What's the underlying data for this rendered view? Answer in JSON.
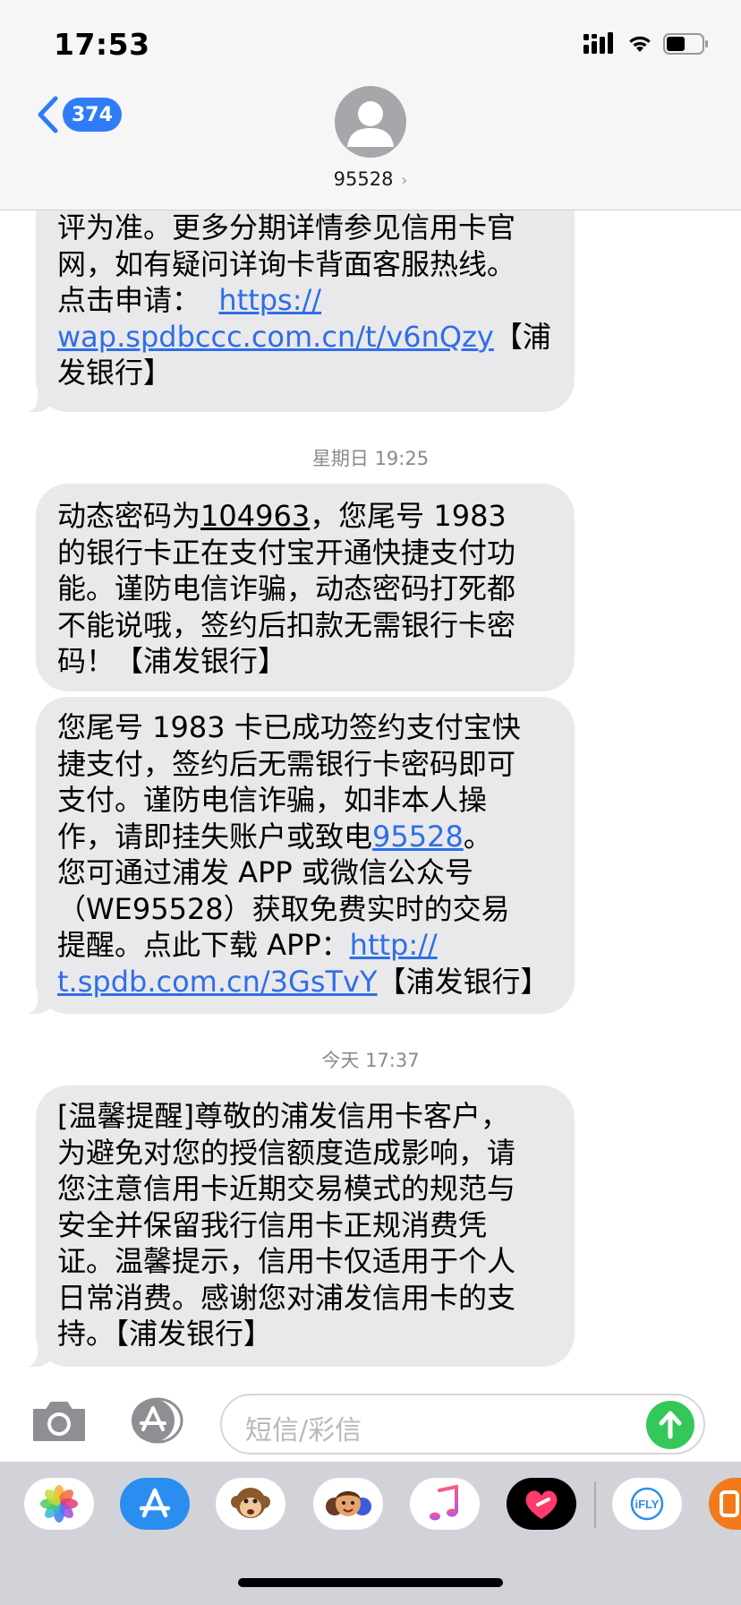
{
  "status_bar": {
    "time": "17:53"
  },
  "header": {
    "back_count": "374",
    "contact_name": "95528",
    "chevron": "›"
  },
  "messages": {
    "m1": {
      "line0": "土",
      "line1": "评为准。更多分期详情参见信用卡官",
      "line2": "网，如有疑问详询卡背面客服热线。",
      "line3": "点击申请：",
      "link_a": "https://",
      "link_b": "wap.spdbccc.com.cn/t/v6nQzy",
      "tail_a": "【浦",
      "tail_b": "发银行】"
    },
    "stamp1": "星期日 19:25",
    "m2": {
      "line1_a": "动态密码为",
      "code": "104963",
      "line1_b": "，您尾号 1983",
      "line2": "的银行卡正在支付宝开通快捷支付功",
      "line3": "能。谨防电信诈骗，动态密码打死都",
      "line4": "不能说哦，签约后扣款无需银行卡密",
      "line5": "码！【浦发银行】"
    },
    "m3": {
      "line1": "您尾号 1983 卡已成功签约支付宝快",
      "line2": "捷支付，签约后无需银行卡密码即可",
      "line3": "支付。谨防电信诈骗，如非本人操",
      "line4_a": "作，请即挂失账户或致电",
      "phone": "95528",
      "line4_b": "。",
      "line5": "您可通过浦发 APP 或微信公众号",
      "line6": "（WE95528）获取免费实时的交易",
      "line7_a": "提醒。点此下载 APP：",
      "link_a": "http://",
      "link_b": "t.spdb.com.cn/3GsTvY",
      "tail": "【浦发银行】"
    },
    "stamp2": "今天 17:37",
    "m4": {
      "line1": "[温馨提醒]尊敬的浦发信用卡客户，",
      "line2": "为避免对您的授信额度造成影响，请",
      "line3": "您注意信用卡近期交易模式的规范与",
      "line4": "安全并保留我行信用卡正规消费凭",
      "line5": "证。温馨提示，信用卡仅适用于个人",
      "line6": "日常消费。感谢您对浦发信用卡的支",
      "line7": "持。【浦发银行】"
    }
  },
  "composer": {
    "placeholder": "短信/彩信"
  },
  "colors": {
    "bubble": "#e9e9eb",
    "link": "#2f6ee6",
    "badge": "#2f7cf6",
    "send": "#34c759"
  },
  "app_drawer": {
    "apps": [
      "photos-icon",
      "app-store-icon",
      "animoji-monkey-icon",
      "memoji-icon",
      "music-icon",
      "digital-touch-icon",
      "ifly-icon",
      "partial-app-icon"
    ],
    "ifly_label": "iFLY"
  }
}
